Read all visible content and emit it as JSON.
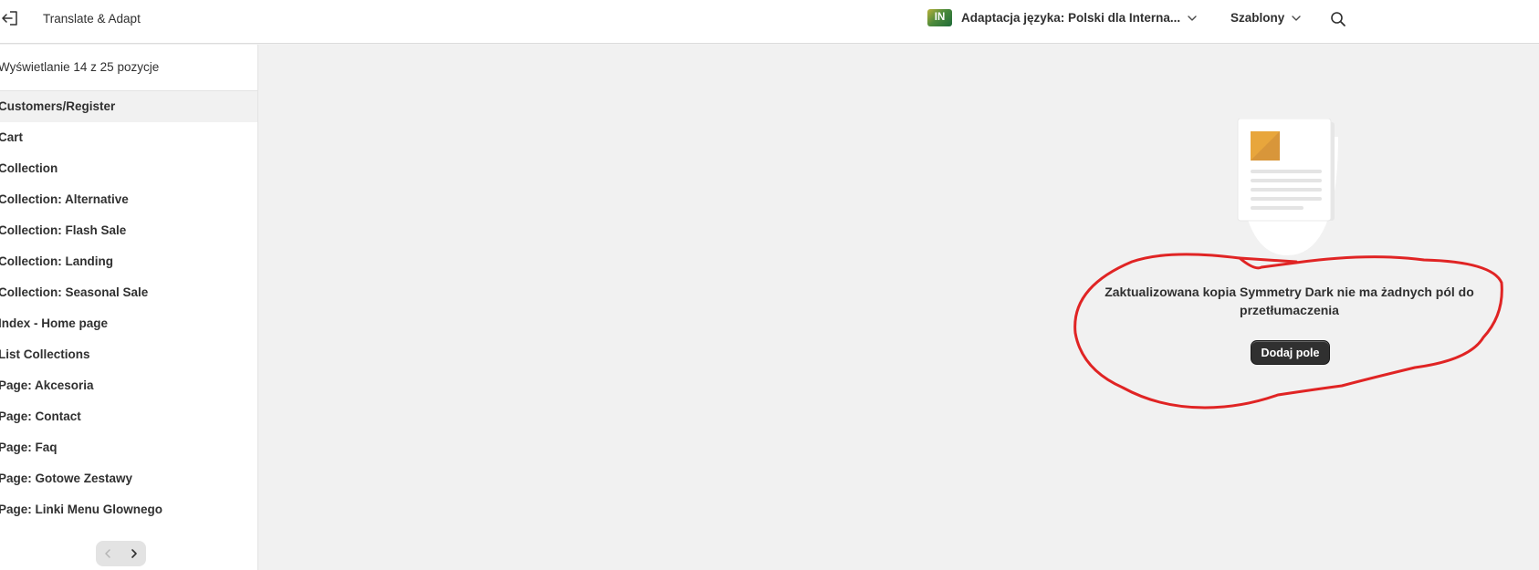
{
  "topbar": {
    "app_title": "Translate & Adapt",
    "locale_badge": "IN",
    "locale_label": "Adaptacja języka: Polski dla Interna...",
    "templates_label": "Szablony",
    "icons": [
      "exit-icon",
      "chevron-down-icon",
      "search-icon"
    ]
  },
  "sidebar": {
    "count_text": "Wyświetlanie 14 z 25 pozycje",
    "items": [
      {
        "label": "Customers/Register",
        "active": true
      },
      {
        "label": "Cart"
      },
      {
        "label": "Collection"
      },
      {
        "label": "Collection: Alternative"
      },
      {
        "label": "Collection: Flash Sale"
      },
      {
        "label": "Collection: Landing"
      },
      {
        "label": "Collection: Seasonal Sale"
      },
      {
        "label": "Index - Home page"
      },
      {
        "label": "List Collections"
      },
      {
        "label": "Page: Akcesoria"
      },
      {
        "label": "Page: Contact"
      },
      {
        "label": "Page: Faq"
      },
      {
        "label": "Page: Gotowe Zestawy"
      },
      {
        "label": "Page: Linki Menu Glownego"
      }
    ],
    "pagination": {
      "prev_icon": "chevron-left-icon",
      "next_icon": "chevron-right-icon"
    }
  },
  "empty_state": {
    "message": "Zaktualizowana kopia Symmetry Dark nie ma żadnych pól do przetłumaczenia",
    "button_label": "Dodaj pole",
    "illustration": "document-illustration"
  },
  "colors": {
    "accent_flag": "#2f7d3a",
    "annotation": "#e02424",
    "button": "#303030",
    "background": "#f1f1f1"
  }
}
